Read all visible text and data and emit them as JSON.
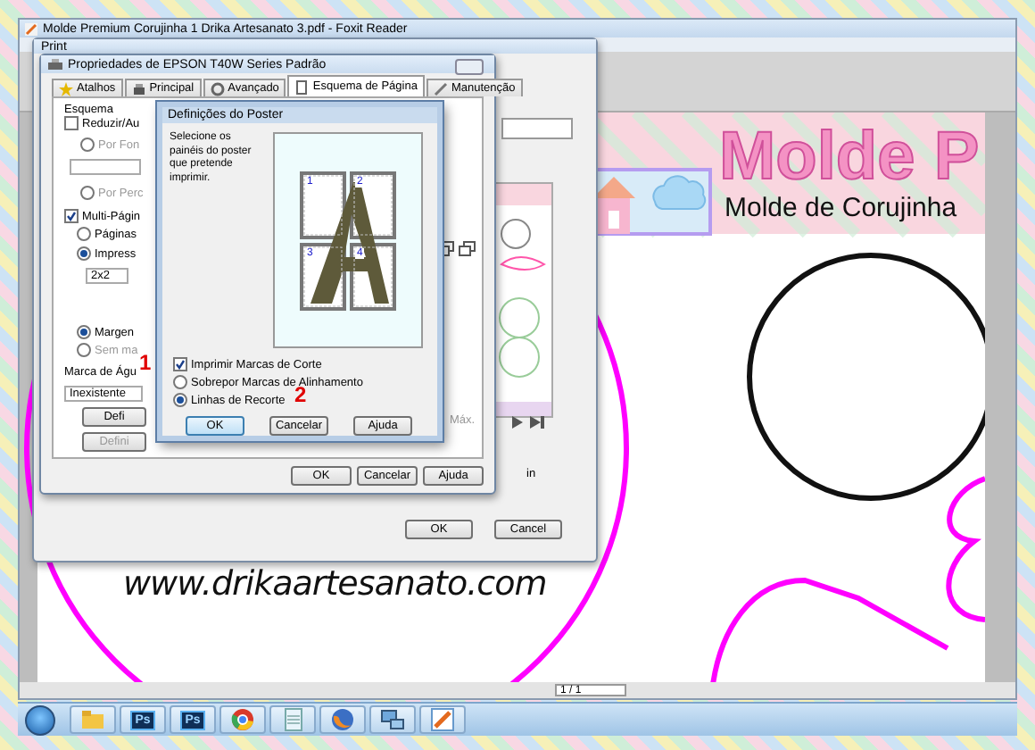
{
  "app_window": {
    "title": "Molde Premium Corujinha 1 Drika Artesanato 3.pdf - Foxit Reader",
    "page_indicator": "1 / 1"
  },
  "pdf_page": {
    "banner_title": "Molde P",
    "banner_subtitle": "Molde de Corujinha",
    "website": "www.drikaartesanato.com"
  },
  "print_dialog": {
    "title": "Print",
    "units": "in",
    "buttons": [
      "OK",
      "Cancel"
    ]
  },
  "properties_dialog": {
    "title": "Propriedades de EPSON T40W Series Padrão",
    "tabs": [
      {
        "label": "Atalhos",
        "selected": false
      },
      {
        "label": "Principal",
        "selected": false
      },
      {
        "label": "Avançado",
        "selected": false
      },
      {
        "label": "Esquema de Página",
        "selected": true
      },
      {
        "label": "Manutenção",
        "selected": false
      }
    ],
    "layout_group": "Esquema",
    "options": [
      {
        "kind": "checkbox",
        "label": "Reduzir/Au",
        "checked": false,
        "disabled": false
      },
      {
        "kind": "radio",
        "label": "Por Fon",
        "selected": false,
        "disabled": true
      },
      {
        "kind": "radio",
        "label": "Por Perc",
        "selected": false,
        "disabled": true
      },
      {
        "kind": "checkbox",
        "label": "Multi-Págin",
        "checked": true,
        "disabled": false
      },
      {
        "kind": "radio",
        "label": "Páginas",
        "selected": false,
        "disabled": false
      },
      {
        "kind": "radio",
        "label": "Impress",
        "selected": true,
        "disabled": false
      },
      {
        "kind": "radio",
        "label": "Margen",
        "selected": true,
        "disabled": false
      },
      {
        "kind": "radio",
        "label": "Sem ma",
        "selected": false,
        "disabled": true
      }
    ],
    "pages_value": "2x2",
    "watermark_group": "Marca de Águ",
    "watermark_value": "Inexistente",
    "watermark_buttons": [
      "Defi",
      "Defini"
    ],
    "max_label": "Máx.",
    "buttons": [
      "OK",
      "Cancelar",
      "Ajuda"
    ]
  },
  "poster_dialog": {
    "title": "Definições do Poster",
    "instructions": "Selecione os painéis do poster que pretende imprimir.",
    "panels": [
      "1",
      "2",
      "3",
      "4"
    ],
    "options": [
      {
        "kind": "checkbox",
        "label": "Imprimir Marcas de Corte",
        "checked": true
      },
      {
        "kind": "radio",
        "label": "Sobrepor Marcas de Alinhamento",
        "selected": false
      },
      {
        "kind": "radio",
        "label": "Linhas de Recorte",
        "selected": true
      }
    ],
    "buttons": [
      "OK",
      "Cancelar",
      "Ajuda"
    ]
  },
  "annotations": [
    {
      "label": "1"
    },
    {
      "label": "2"
    }
  ],
  "taskbar": {
    "items": [
      {
        "kind": "folder"
      },
      {
        "kind": "ps",
        "label": "Ps"
      },
      {
        "kind": "ps",
        "label": "Ps"
      },
      {
        "kind": "chrome"
      },
      {
        "kind": "notepad"
      },
      {
        "kind": "firefox"
      },
      {
        "kind": "network"
      },
      {
        "kind": "foxit"
      }
    ]
  }
}
